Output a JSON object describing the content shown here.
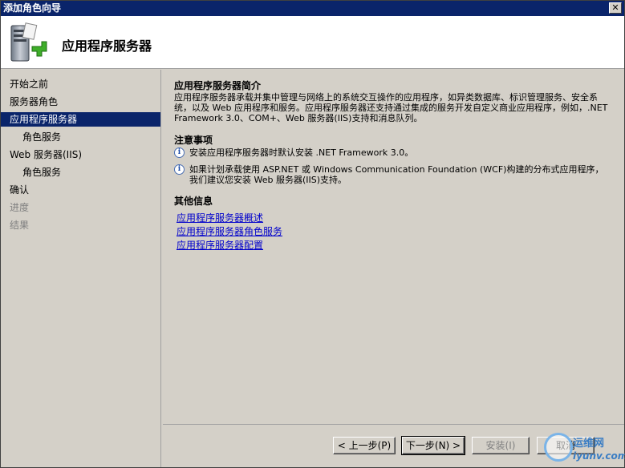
{
  "window": {
    "title": "添加角色向导"
  },
  "header": {
    "title": "应用程序服务器"
  },
  "nav": {
    "items": [
      {
        "label": "开始之前",
        "state": "normal",
        "sub": false
      },
      {
        "label": "服务器角色",
        "state": "normal",
        "sub": false
      },
      {
        "label": "应用程序服务器",
        "state": "active",
        "sub": false
      },
      {
        "label": "角色服务",
        "state": "normal",
        "sub": true
      },
      {
        "label": "Web 服务器(IIS)",
        "state": "normal",
        "sub": false
      },
      {
        "label": "角色服务",
        "state": "normal",
        "sub": true
      },
      {
        "label": "确认",
        "state": "normal",
        "sub": false
      },
      {
        "label": "进度",
        "state": "disabled",
        "sub": false
      },
      {
        "label": "结果",
        "state": "disabled",
        "sub": false
      }
    ]
  },
  "content": {
    "intro_title": "应用程序服务器简介",
    "intro_text": "应用程序服务器承载并集中管理与网络上的系统交互操作的应用程序，如异类数据库、标识管理服务、安全系统，以及 Web 应用程序和服务。应用程序服务器还支持通过集成的服务开发自定义商业应用程序，例如，.NET Framework 3.0、COM+、Web 服务器(IIS)支持和消息队列。",
    "notes_title": "注意事项",
    "notes": [
      "安装应用程序服务器时默认安装 .NET Framework 3.0。",
      "如果计划承载使用 ASP.NET 或 Windows Communication Foundation (WCF)构建的分布式应用程序，我们建议您安装 Web 服务器(IIS)支持。"
    ],
    "more_title": "其他信息",
    "links": [
      "应用程序服务器概述",
      "应用程序服务器角色服务",
      "应用程序服务器配置"
    ]
  },
  "footer": {
    "back_label": "< 上一步(P)",
    "next_label": "下一步(N) >",
    "install_label": "安装(I)",
    "cancel_label": "取消"
  },
  "watermark": {
    "line1": "运维网",
    "line2": "iyunv.com"
  }
}
